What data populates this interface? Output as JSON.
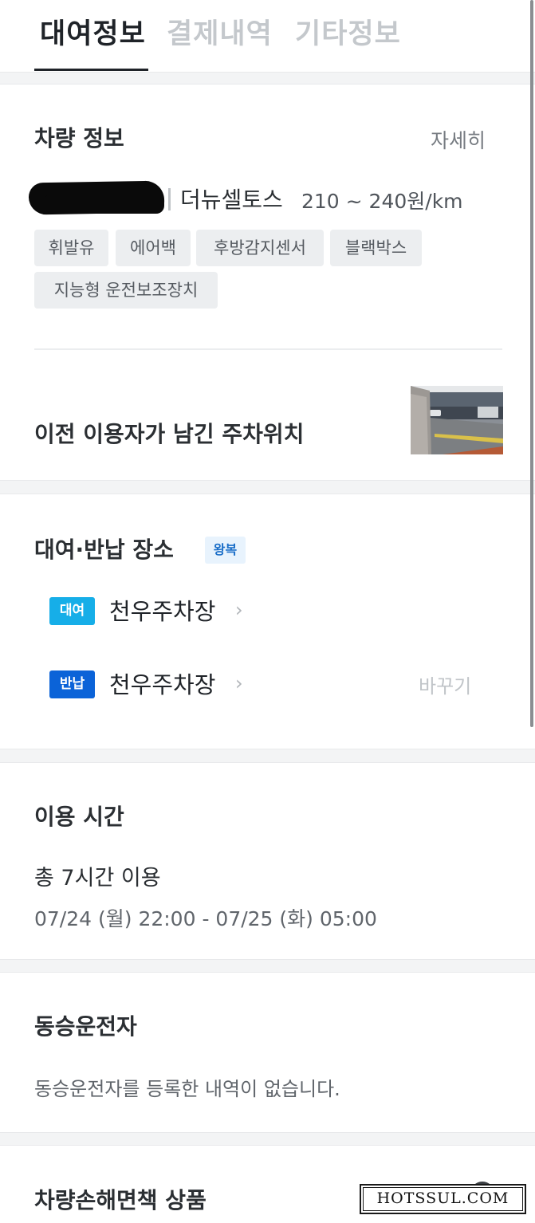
{
  "tabs": [
    {
      "label": "대여정보"
    },
    {
      "label": "결제내역"
    },
    {
      "label": "기타정보"
    }
  ],
  "vehicle": {
    "title": "차량 정보",
    "detail_link": "자세히",
    "model": "더뉴셀토스",
    "price": "210 ~ 240원/km",
    "options": [
      "휘발유",
      "에어백",
      "후방감지센서",
      "블랙박스",
      "지능형 운전보조장치"
    ]
  },
  "parking": {
    "title": "이전 이용자가 남긴 주차위치"
  },
  "location": {
    "title": "대여·반납 장소",
    "round_trip_badge": "왕복",
    "pickup": {
      "tag": "대여",
      "name": "천우주차장"
    },
    "return": {
      "tag": "반납",
      "name": "천우주차장",
      "change_label": "바꾸기"
    }
  },
  "usage": {
    "title": "이용 시간",
    "total": "총 7시간 이용",
    "range": "07/24 (월) 22:00 - 07/25 (화) 05:00"
  },
  "co_driver": {
    "title": "동승운전자",
    "empty_message": "동승운전자를 등록한 내역이 없습니다."
  },
  "insurance": {
    "title": "차량손해면책 상품"
  },
  "watermark": {
    "text": "HOTSSUL.COM"
  },
  "colors": {
    "pickup_tag": "#16aee8",
    "return_tag": "#0b63d8",
    "badge_text": "#1a6ec8"
  }
}
